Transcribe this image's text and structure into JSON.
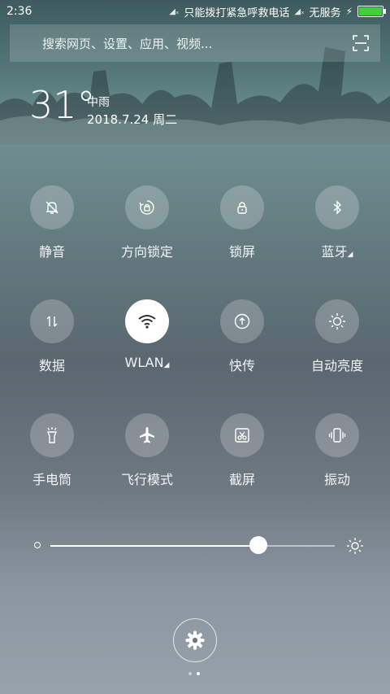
{
  "status_bar": {
    "time": "2:36",
    "emergency_text": "只能拨打紧急呼救电话",
    "service_text": "无服务",
    "battery_color": "#3ecf3a"
  },
  "search": {
    "placeholder": "搜索网页、设置、应用、视频..."
  },
  "weather": {
    "temperature": "31°",
    "condition": "中雨",
    "date": "2018.7.24 周二"
  },
  "tiles": [
    {
      "label": "静音",
      "icon": "bell-off-icon",
      "active": false
    },
    {
      "label": "方向锁定",
      "icon": "rotation-lock-icon",
      "active": false
    },
    {
      "label": "锁屏",
      "icon": "lock-icon",
      "active": false
    },
    {
      "label": "蓝牙",
      "icon": "bluetooth-icon",
      "active": false,
      "has_more": true
    },
    {
      "label": "数据",
      "icon": "mobile-data-icon",
      "active": false
    },
    {
      "label": "WLAN",
      "icon": "wifi-icon",
      "active": true,
      "has_more": true
    },
    {
      "label": "快传",
      "icon": "quick-transfer-icon",
      "active": false
    },
    {
      "label": "自动亮度",
      "icon": "auto-brightness-icon",
      "active": false
    },
    {
      "label": "手电筒",
      "icon": "flashlight-icon",
      "active": false
    },
    {
      "label": "飞行模式",
      "icon": "airplane-icon",
      "active": false
    },
    {
      "label": "截屏",
      "icon": "screenshot-icon",
      "active": false
    },
    {
      "label": "振动",
      "icon": "vibrate-icon",
      "active": false
    }
  ],
  "brightness": {
    "level": 0.73
  },
  "pager": {
    "pages": 2,
    "current": 2
  }
}
